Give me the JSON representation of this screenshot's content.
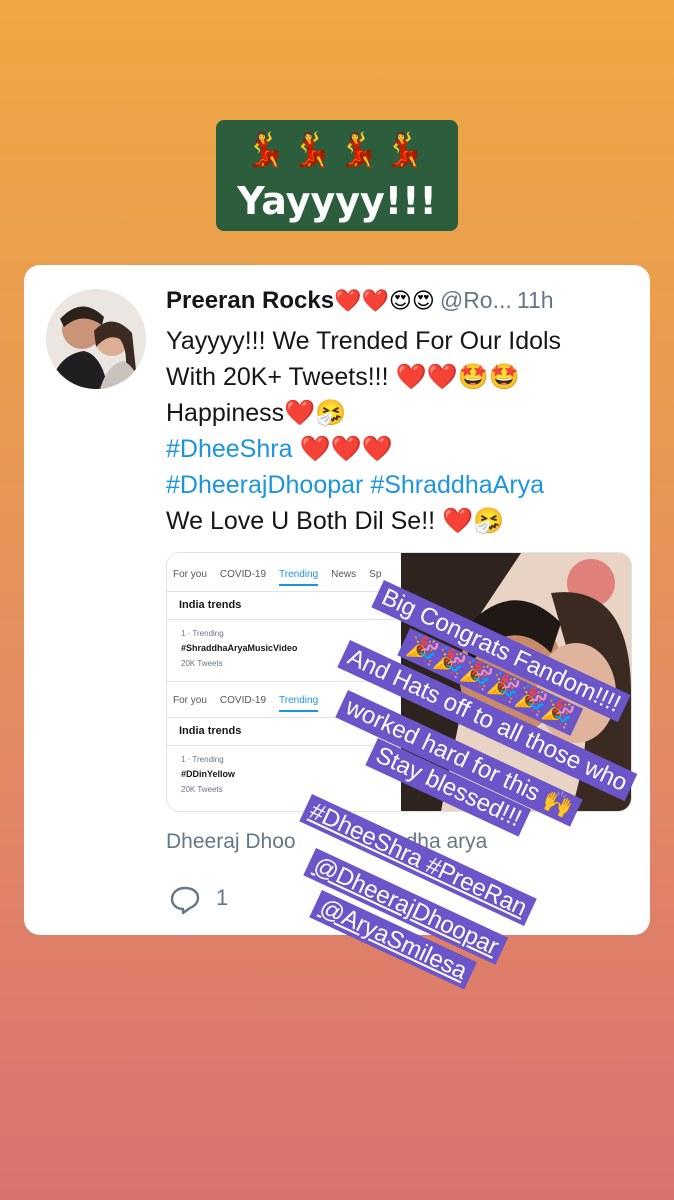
{
  "top_sticker": {
    "emojis": "💃💃💃💃",
    "text": "Yayyyy!!!"
  },
  "tweet": {
    "author": "Preeran Rocks",
    "author_emojis": "❤️❤️😍😍",
    "handle": "@Ro...",
    "time": "11h",
    "line1": "Yayyyy!!! We Trended For Our Idols",
    "line2_text": "With 20K+ Tweets!!!",
    "line2_emojis": "❤️❤️🤩🤩",
    "line3_text": "Happiness",
    "line3_emojis": "❤️🤧",
    "hashtag1": "#DheeShra",
    "hashtag1_emojis": "❤️❤️❤️",
    "hashtag2": "#DheerajDhoopar",
    "hashtag3": "#ShraddhaArya",
    "line6_text": "We Love U Both Dil Se!!",
    "line6_emojis": "❤️🤧",
    "embed_title_visible": "Dheeraj Dhoo",
    "embed_title_end": "dha arya",
    "reply_count": "1"
  },
  "trends_screenshot": {
    "tabs": [
      "For you",
      "COVID-19",
      "Trending",
      "News",
      "Sp"
    ],
    "active_tab": "Trending",
    "section_title": "India trends",
    "trend1": {
      "meta": "1 · Trending",
      "name": "#ShraddhaAryaMusicVideo",
      "count": "20K Tweets"
    },
    "trend2": {
      "meta": "1 · Trending",
      "name": "#DDinYellow",
      "count": "20K Tweets"
    }
  },
  "overlay_text": {
    "line1": "Big Congrats Fandom!!!!",
    "line2": "🎉🎉🎉🎉🎉🎉",
    "line3": "And Hats off to all those who",
    "line4": "worked hard for this 🙌",
    "line5": "Stay blessed!!!",
    "line6": "#DheeShra #PreeRan",
    "line7": "@DheerajDhoopar",
    "line8": "@AryaSmilesa"
  }
}
